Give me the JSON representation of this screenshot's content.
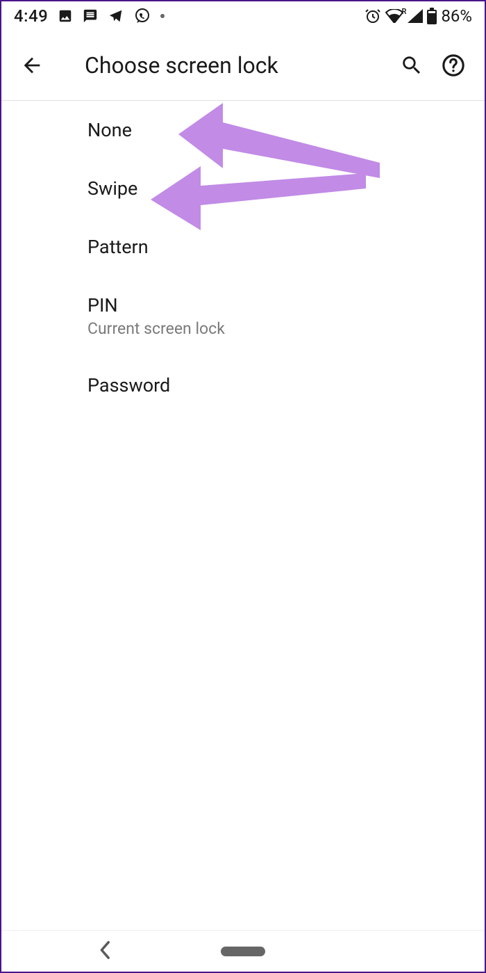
{
  "status_bar": {
    "time": "4:49",
    "battery": "86%",
    "roaming": "R"
  },
  "app_bar": {
    "title": "Choose screen lock"
  },
  "options": [
    {
      "label": "None",
      "sublabel": ""
    },
    {
      "label": "Swipe",
      "sublabel": ""
    },
    {
      "label": "Pattern",
      "sublabel": ""
    },
    {
      "label": "PIN",
      "sublabel": "Current screen lock"
    },
    {
      "label": "Password",
      "sublabel": ""
    }
  ],
  "annotation_color": "#c18be6"
}
